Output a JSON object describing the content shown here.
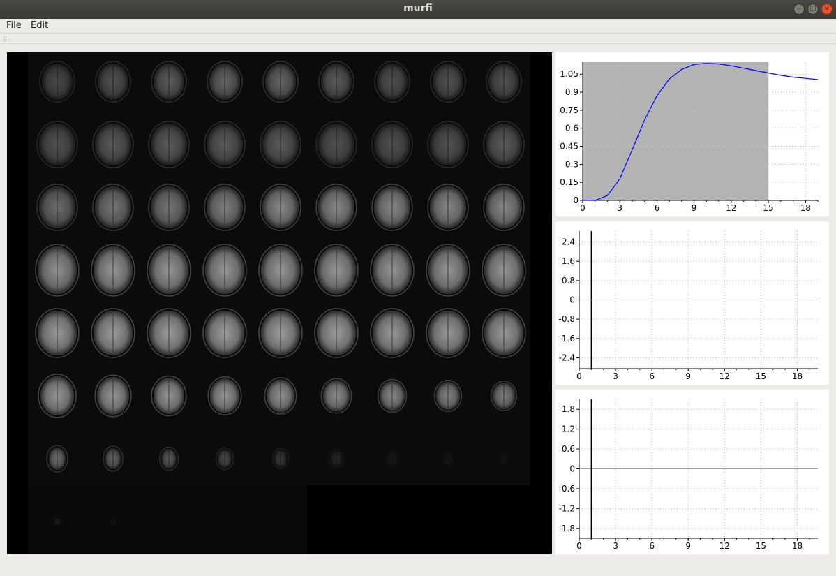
{
  "window": {
    "title": "murfi"
  },
  "window_controls": {
    "minimize": "–",
    "maximize": "□",
    "close": "×"
  },
  "menu": [
    "File",
    "Edit"
  ],
  "viewer": {
    "rows": 8,
    "cols": 9,
    "slice_count": 65,
    "slice_intensity": [
      0.35,
      0.4,
      0.45,
      0.5,
      0.5,
      0.45,
      0.4,
      0.4,
      0.4,
      0.4,
      0.45,
      0.45,
      0.45,
      0.45,
      0.4,
      0.4,
      0.4,
      0.45,
      0.55,
      0.6,
      0.6,
      0.65,
      0.7,
      0.7,
      0.7,
      0.7,
      0.7,
      0.75,
      0.78,
      0.78,
      0.78,
      0.78,
      0.78,
      0.78,
      0.78,
      0.78,
      0.8,
      0.82,
      0.82,
      0.82,
      0.82,
      0.82,
      0.8,
      0.8,
      0.8,
      0.78,
      0.78,
      0.78,
      0.78,
      0.75,
      0.72,
      0.7,
      0.68,
      0.65,
      0.55,
      0.5,
      0.45,
      0.35,
      0.25,
      0.15,
      0.08,
      0.06,
      0.05,
      0.1,
      0.06
    ]
  },
  "chart_data": [
    {
      "type": "line",
      "x_ticks": [
        "0",
        "3",
        "6",
        "9",
        "12",
        "15",
        "18"
      ],
      "y_ticks": [
        "0",
        "0.15",
        "0.3",
        "0.45",
        "0.6",
        "0.75",
        "0.9",
        "1.05"
      ],
      "xlim": [
        0,
        19
      ],
      "ylim": [
        0,
        1.15
      ],
      "shaded_region": {
        "x": [
          0,
          15
        ],
        "color": "#b3b3b3"
      },
      "series": [
        {
          "color": "#0000ff",
          "x": [
            0,
            1,
            2,
            3,
            4,
            5,
            6,
            7,
            8,
            9,
            10,
            11,
            12,
            13,
            14,
            15,
            16,
            17,
            18,
            19
          ],
          "y": [
            0,
            0.0,
            0.04,
            0.18,
            0.42,
            0.67,
            0.87,
            1.01,
            1.09,
            1.13,
            1.14,
            1.135,
            1.12,
            1.1,
            1.08,
            1.06,
            1.04,
            1.025,
            1.015,
            1.005
          ]
        }
      ],
      "grid": true
    },
    {
      "type": "line",
      "x_ticks": [
        "0",
        "3",
        "6",
        "9",
        "12",
        "15",
        "18"
      ],
      "y_ticks": [
        "2.4",
        "1.6",
        "0.8",
        "0",
        "-0.8",
        "-1.6",
        "-2.4"
      ],
      "xlim": [
        0,
        19.7
      ],
      "ylim": [
        -2.85,
        2.85
      ],
      "cursor_x": 1,
      "series": [],
      "grid": true
    },
    {
      "type": "line",
      "x_ticks": [
        "0",
        "3",
        "6",
        "9",
        "12",
        "15",
        "18"
      ],
      "y_ticks": [
        "1.8",
        "1.2",
        "0.6",
        "0",
        "-0.6",
        "-1.2",
        "-1.8"
      ],
      "xlim": [
        0,
        19.7
      ],
      "ylim": [
        -2.1,
        2.1
      ],
      "cursor_x": 1,
      "series": [],
      "grid": true
    }
  ]
}
